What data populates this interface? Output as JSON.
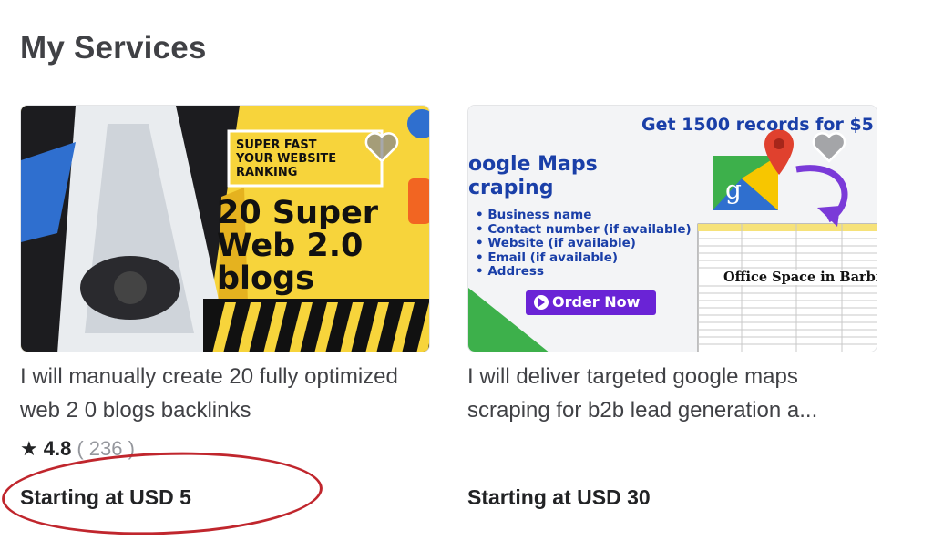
{
  "page": {
    "title": "My Services"
  },
  "services": [
    {
      "description": "I will manually create 20 fully optimized web 2 0 blogs backlinks",
      "rating": {
        "score": "4.8",
        "count": "( 236 )"
      },
      "price": "Starting at USD 5",
      "thumbnail": {
        "banner_line1": "SUPER FAST",
        "banner_line2": "YOUR WEBSITE",
        "banner_line3": "RANKING",
        "headline_line1": "20 Super",
        "headline_line2": "Web 2.0",
        "headline_line3": "blogs"
      },
      "favorite_icon": "heart-icon"
    },
    {
      "description": "I will deliver targeted google maps scraping for b2b lead generation a...",
      "price": "Starting at USD 30",
      "thumbnail": {
        "top_text": "Get 1500 records for $5",
        "title_line1": "oogle Maps",
        "title_line2": "craping",
        "bullets": [
          "• Business name",
          "• Contact number (if available)",
          "• Website (if available)",
          "• Email (if available)",
          "• Address"
        ],
        "order_button": "Order Now",
        "sheet_caption": "Office Space in Barbi",
        "logo_letter": "g"
      },
      "favorite_icon": "heart-icon"
    }
  ],
  "colors": {
    "yellow": "#f7d43b",
    "annotation_red": "#c0262d",
    "blue_text": "#1a3fa8",
    "order_purple": "#6a23d6"
  }
}
